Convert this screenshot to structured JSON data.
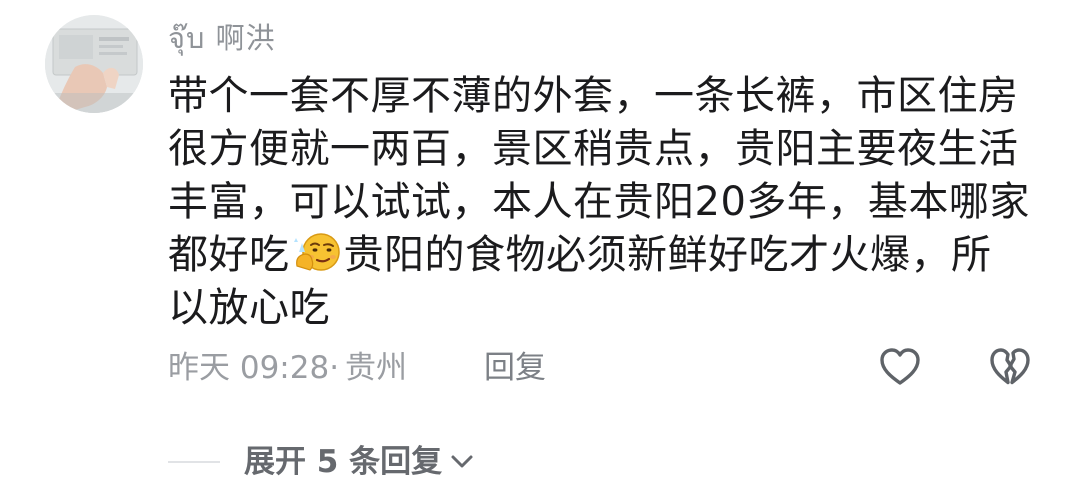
{
  "comment": {
    "username": "จุ๊บ 啊洪",
    "avatar_icon": "avatar-photo",
    "lines": [
      "带个一套不厚不薄的外套，一条长裤，市区住房",
      "很方便就一两百，景区稍贵点，贵阳主要夜生活",
      "丰富，可以试试，本人在贵阳20多年，基本哪家"
    ],
    "line4_before_emoji": "都好吃",
    "emoji_icon": "thinking-wink-emoji",
    "line4_after_emoji": "贵阳的食物必须新鲜好吃才火爆，所",
    "line5": "以放心吃",
    "time": "昨天 09:28·",
    "location": "贵州",
    "reply_label": "回复",
    "like_icon": "heart-outline-icon",
    "dislike_icon": "broken-heart-outline-icon"
  },
  "replies": {
    "expand_label": "展开 5 条回复",
    "chevron_icon": "chevron-down-icon"
  },
  "colors": {
    "text_primary": "#1b1b1d",
    "text_secondary": "#9a9da2",
    "icon_gray": "#5f6368"
  }
}
